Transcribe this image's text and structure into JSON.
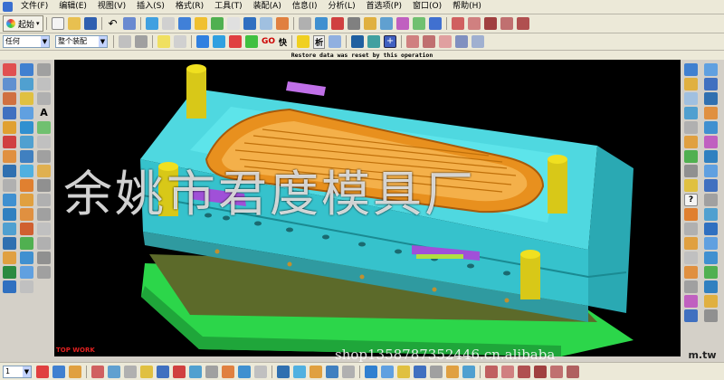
{
  "menu": {
    "items": [
      "文件(F)",
      "编辑(E)",
      "视图(V)",
      "插入(S)",
      "格式(R)",
      "工具(T)",
      "装配(A)",
      "信息(I)",
      "分析(L)",
      "首选项(P)",
      "窗口(O)",
      "帮助(H)"
    ]
  },
  "toolbar": {
    "start_label": "起始",
    "select_filter": "任何",
    "assembly_scope": "整个装配",
    "go_label": "GO",
    "quick_label": "快",
    "analysis_label": "析"
  },
  "status": {
    "message": "Restore data was reset by this operation"
  },
  "viewport": {
    "label": "TOP WORK"
  },
  "overlay": {
    "watermark": "余姚市君度模具厂",
    "shop_url": "shop1358787352446.cn.alibaba",
    "tld": "m.tw"
  },
  "bottombar": {
    "page_value": "1"
  },
  "colors": {
    "plate_cyan": "#4fd8e0",
    "frame_green": "#2cd64a",
    "pillar_yellow": "#f0e020",
    "core_orange": "#e8901e",
    "slider_purple": "#a050d8",
    "watermark_label_red": "#e02020"
  }
}
